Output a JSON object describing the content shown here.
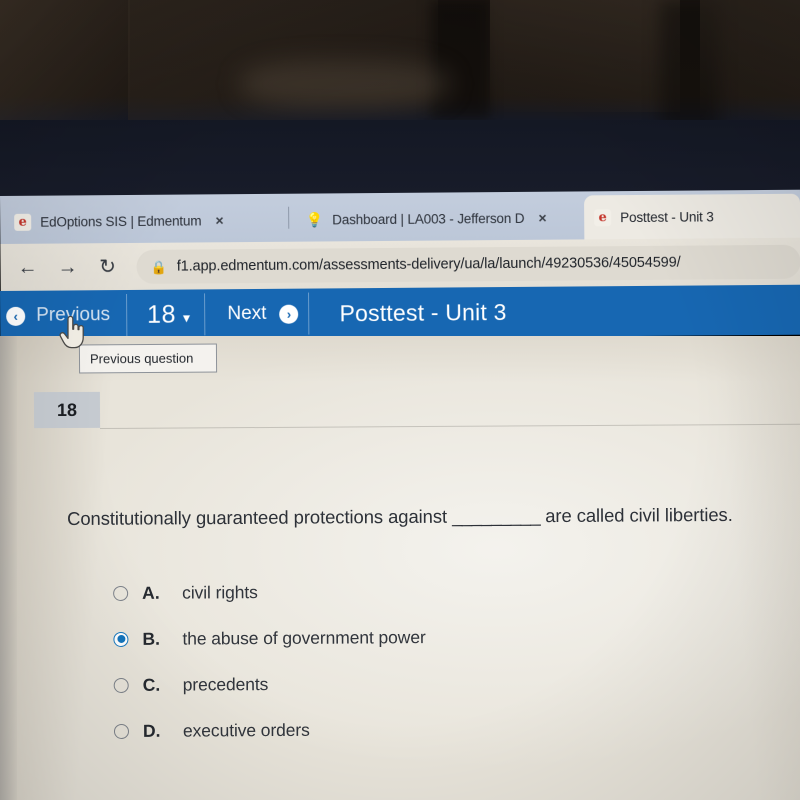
{
  "browser": {
    "tabs": [
      {
        "title": "EdOptions SIS | Edmentum",
        "favicon": "edmentum-icon",
        "active": false,
        "close_label": "×"
      },
      {
        "title": "Dashboard | LA003 - Jefferson D",
        "favicon": "lightbulb-icon",
        "active": false,
        "close_label": "×"
      },
      {
        "title": "Posttest - Unit 3",
        "favicon": "edmentum-icon",
        "active": true,
        "close_label": ""
      }
    ],
    "nav": {
      "back_icon": "←",
      "forward_icon": "→",
      "reload_icon": "↻"
    },
    "omnibox": {
      "lock_icon": "🔒",
      "url": "f1.app.edmentum.com/assessments-delivery/ua/la/launch/49230536/45054599/"
    }
  },
  "toolbar": {
    "previous_label": "Previous",
    "question_number": "18",
    "caret_icon": "⌄",
    "next_label": "Next",
    "title": "Posttest - Unit 3",
    "prev_arrow": "‹",
    "next_arrow": "›",
    "accent_color": "#1767b2"
  },
  "tooltip": {
    "text": "Previous question"
  },
  "question": {
    "number": "18",
    "text_before": "Constitutionally guaranteed protections against",
    "blank": "_________",
    "text_after": "are called civil liberties.",
    "options": [
      {
        "letter": "A.",
        "text": "civil rights",
        "selected": false
      },
      {
        "letter": "B.",
        "text": "the abuse of government power",
        "selected": true
      },
      {
        "letter": "C.",
        "text": "precedents",
        "selected": false
      },
      {
        "letter": "D.",
        "text": "executive orders",
        "selected": false
      }
    ]
  }
}
